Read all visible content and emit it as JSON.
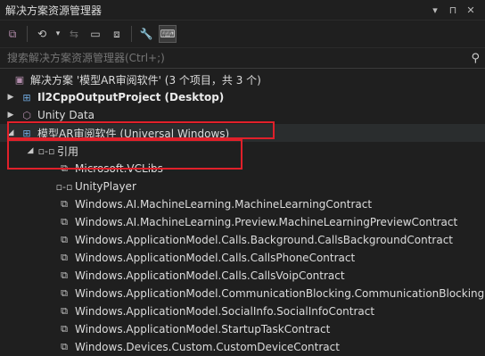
{
  "window": {
    "title": "解决方案资源管理器",
    "btn_dropdown": "▾",
    "btn_pin": "⊓",
    "btn_close": "✕"
  },
  "search": {
    "placeholder": "搜索解决方案资源管理器(Ctrl+;)"
  },
  "tree": {
    "solution": "解决方案 '模型AR审阅软件' (3 个项目，共 3 个)",
    "projects": [
      {
        "label": "Il2CppOutputProject (Desktop)"
      },
      {
        "label": "Unity Data"
      },
      {
        "label": "模型AR审阅软件 (Universal Windows)"
      }
    ],
    "references_label": "引用",
    "references": [
      "Microsoft.VCLibs",
      "UnityPlayer",
      "Windows.AI.MachineLearning.MachineLearningContract",
      "Windows.AI.MachineLearning.Preview.MachineLearningPreviewContract",
      "Windows.ApplicationModel.Calls.Background.CallsBackgroundContract",
      "Windows.ApplicationModel.Calls.CallsPhoneContract",
      "Windows.ApplicationModel.Calls.CallsVoipContract",
      "Windows.ApplicationModel.CommunicationBlocking.CommunicationBlocking",
      "Windows.ApplicationModel.SocialInfo.SocialInfoContract",
      "Windows.ApplicationModel.StartupTaskContract",
      "Windows.Devices.Custom.CustomDeviceContract"
    ]
  }
}
